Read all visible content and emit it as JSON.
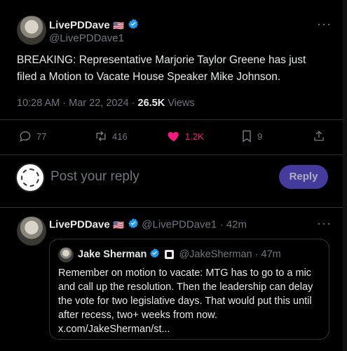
{
  "main_tweet": {
    "name": "LivePDDave",
    "flag": "🇺🇸",
    "handle": "@LivePDDave1",
    "text": "BREAKING: Representative Marjorie Taylor Greene has just filed a Motion to Vacate House Speaker Mike Johnson.",
    "time": "10:28 AM",
    "date": "Mar 22, 2024",
    "views_count": "26.5K",
    "views_label": "Views",
    "actions": {
      "replies": "77",
      "retweets": "416",
      "likes": "1.2K",
      "bookmarks": "9"
    },
    "more_label": "···"
  },
  "reply_box": {
    "placeholder": "Post your reply",
    "button_label": "Reply"
  },
  "reply_tweet": {
    "name": "LivePDDave",
    "flag": "🇺🇸",
    "handle": "@LivePDDave1",
    "age": "42m",
    "more_label": "···",
    "quote": {
      "name": "Jake Sherman",
      "handle": "@JakeSherman",
      "age": "47m",
      "text": "Remember on motion to vacate: MTG has to go to a mic and call up the resolution. Then the leadership can delay the vote for two legislative days. That would put this until after recess, two+ weeks from now.",
      "link": "x.com/JakeSherman/st..."
    }
  },
  "colors": {
    "accent_pink": "#f91880",
    "verified_blue": "#1d9bf0",
    "reply_button": "#5b4fd1"
  }
}
